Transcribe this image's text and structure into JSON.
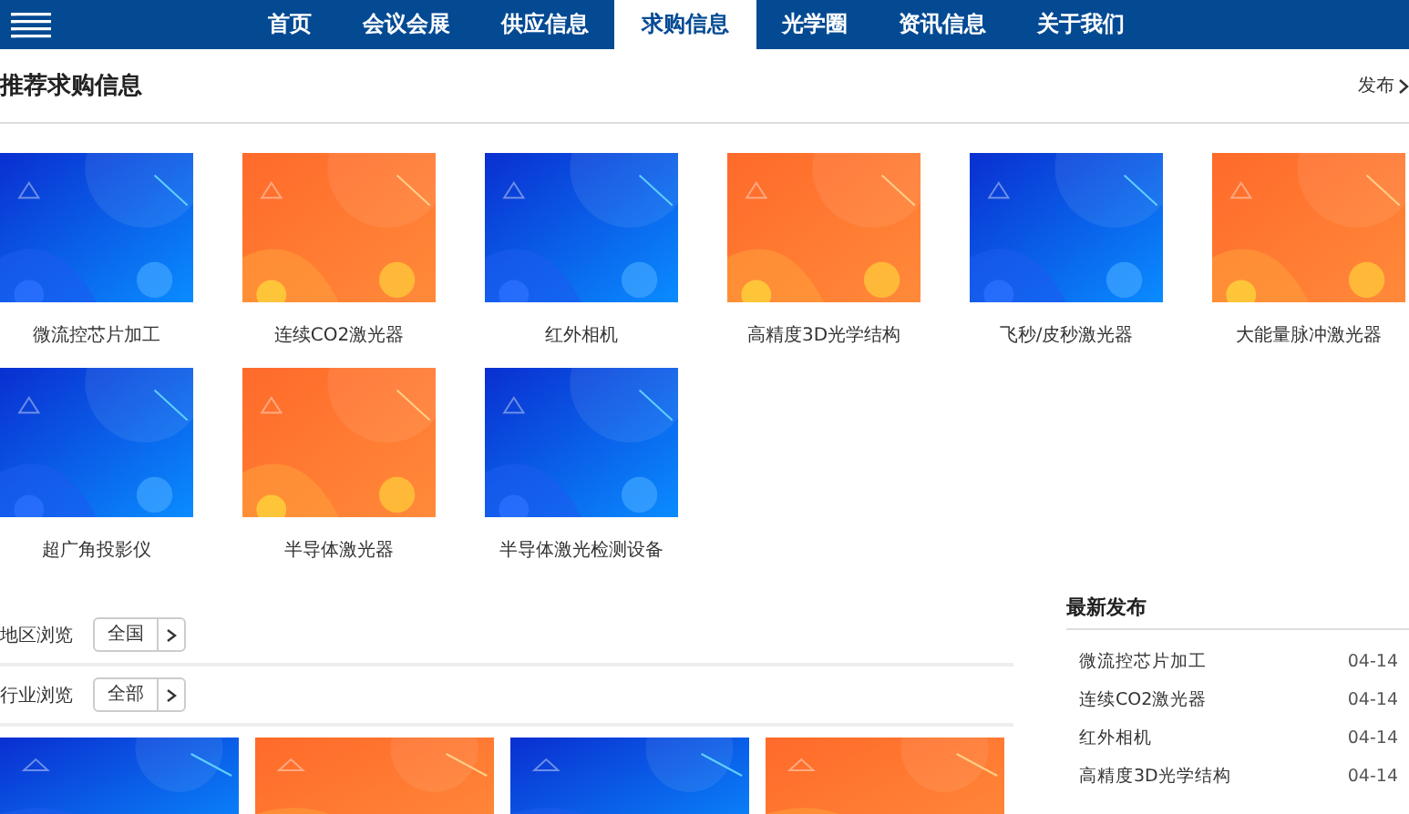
{
  "nav": {
    "tabs": [
      {
        "label": "首页",
        "selected": false
      },
      {
        "label": "会议会展",
        "selected": false
      },
      {
        "label": "供应信息",
        "selected": false
      },
      {
        "label": "求购信息",
        "selected": true
      },
      {
        "label": "光学圈",
        "selected": false
      },
      {
        "label": "资讯信息",
        "selected": false
      },
      {
        "label": "关于我们",
        "selected": false
      }
    ]
  },
  "section": {
    "title": "推荐求购信息",
    "link": "发布"
  },
  "cards": [
    {
      "kind": "blue",
      "caption": "微流控芯片加工"
    },
    {
      "kind": "orange",
      "caption": "连续CO2激光器"
    },
    {
      "kind": "blue",
      "caption": "红外相机"
    },
    {
      "kind": "orange",
      "caption": "高精度3D光学结构"
    },
    {
      "kind": "blue",
      "caption": "飞秒/皮秒激光器"
    },
    {
      "kind": "orange",
      "caption": "大能量脉冲激光器"
    },
    {
      "kind": "blue",
      "caption": "超广角投影仪"
    },
    {
      "kind": "orange",
      "caption": "半导体激光器"
    },
    {
      "kind": "blue",
      "caption": "半导体激光检测设备"
    }
  ],
  "filters": [
    {
      "label": "地区浏览",
      "value": "全国"
    },
    {
      "label": "行业浏览",
      "value": "全部"
    }
  ],
  "bottom_cards": [
    {
      "kind": "blue"
    },
    {
      "kind": "orange"
    },
    {
      "kind": "blue"
    },
    {
      "kind": "orange"
    }
  ],
  "latest": {
    "title": "最新发布",
    "items": [
      {
        "name": "微流控芯片加工",
        "date": "04-14"
      },
      {
        "name": "连续CO2激光器",
        "date": "04-14"
      },
      {
        "name": "红外相机",
        "date": "04-14"
      },
      {
        "name": "高精度3D光学结构",
        "date": "04-14"
      }
    ]
  }
}
